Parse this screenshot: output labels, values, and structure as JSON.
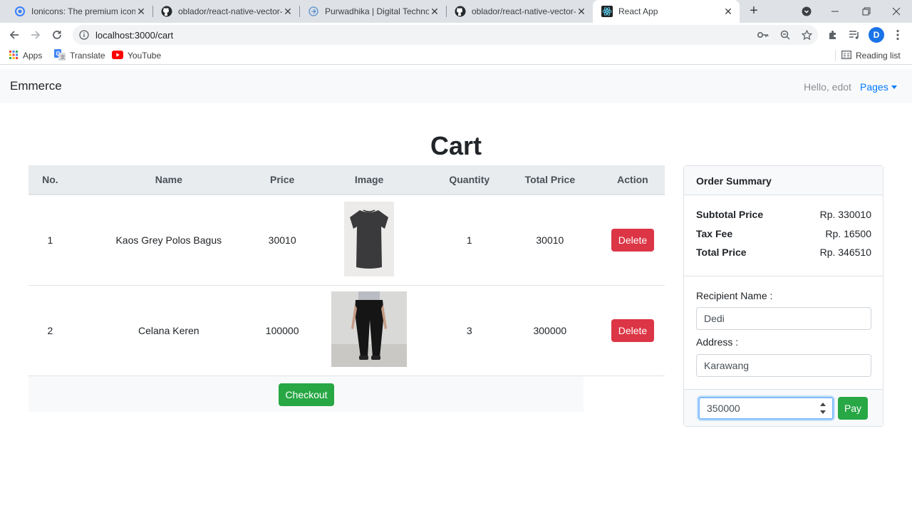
{
  "browser": {
    "tabs": [
      {
        "title": "Ionicons: The premium icon p",
        "icon": "ionicons-icon",
        "active": false
      },
      {
        "title": "oblador/react-native-vector-i",
        "icon": "github-icon",
        "active": false
      },
      {
        "title": "Purwadhika | Digital Technolo",
        "icon": "purwadhika-icon",
        "active": false
      },
      {
        "title": "oblador/react-native-vector-i",
        "icon": "github-icon",
        "active": false
      },
      {
        "title": "React App",
        "icon": "react-icon",
        "active": true
      }
    ],
    "url": "localhost:3000/cart",
    "profile_initial": "D",
    "bookmarks": [
      {
        "label": "Apps",
        "icon": "apps-grid-icon"
      },
      {
        "label": "Translate",
        "icon": "translate-icon"
      },
      {
        "label": "YouTube",
        "icon": "youtube-icon"
      }
    ],
    "reading_list": "Reading list"
  },
  "navbar": {
    "brand": "Emmerce",
    "greeting": "Hello, edot",
    "pages_label": "Pages"
  },
  "page": {
    "title": "Cart"
  },
  "cart_table": {
    "headers": [
      "No.",
      "Name",
      "Price",
      "Image",
      "Quantity",
      "Total Price",
      "Action"
    ],
    "rows": [
      {
        "no": "1",
        "name": "Kaos Grey Polos Bagus",
        "price": "30010",
        "image": "grey-tshirt-image",
        "quantity": "1",
        "total": "30010",
        "action": "Delete"
      },
      {
        "no": "2",
        "name": "Celana Keren",
        "price": "100000",
        "image": "black-pants-image",
        "quantity": "3",
        "total": "300000",
        "action": "Delete"
      }
    ],
    "checkout_label": "Checkout"
  },
  "order_summary": {
    "title": "Order Summary",
    "subtotal_label": "Subtotal Price",
    "subtotal_value": "Rp. 330010",
    "tax_label": "Tax Fee",
    "tax_value": "Rp. 16500",
    "total_label": "Total Price",
    "total_value": "Rp. 346510",
    "recipient_label": "Recipient Name :",
    "recipient_value": "Dedi",
    "address_label": "Address :",
    "address_value": "Karawang",
    "payment_value": "350000",
    "pay_label": "Pay"
  },
  "colors": {
    "danger": "#dc3545",
    "success": "#28a745",
    "link": "#007bff"
  }
}
